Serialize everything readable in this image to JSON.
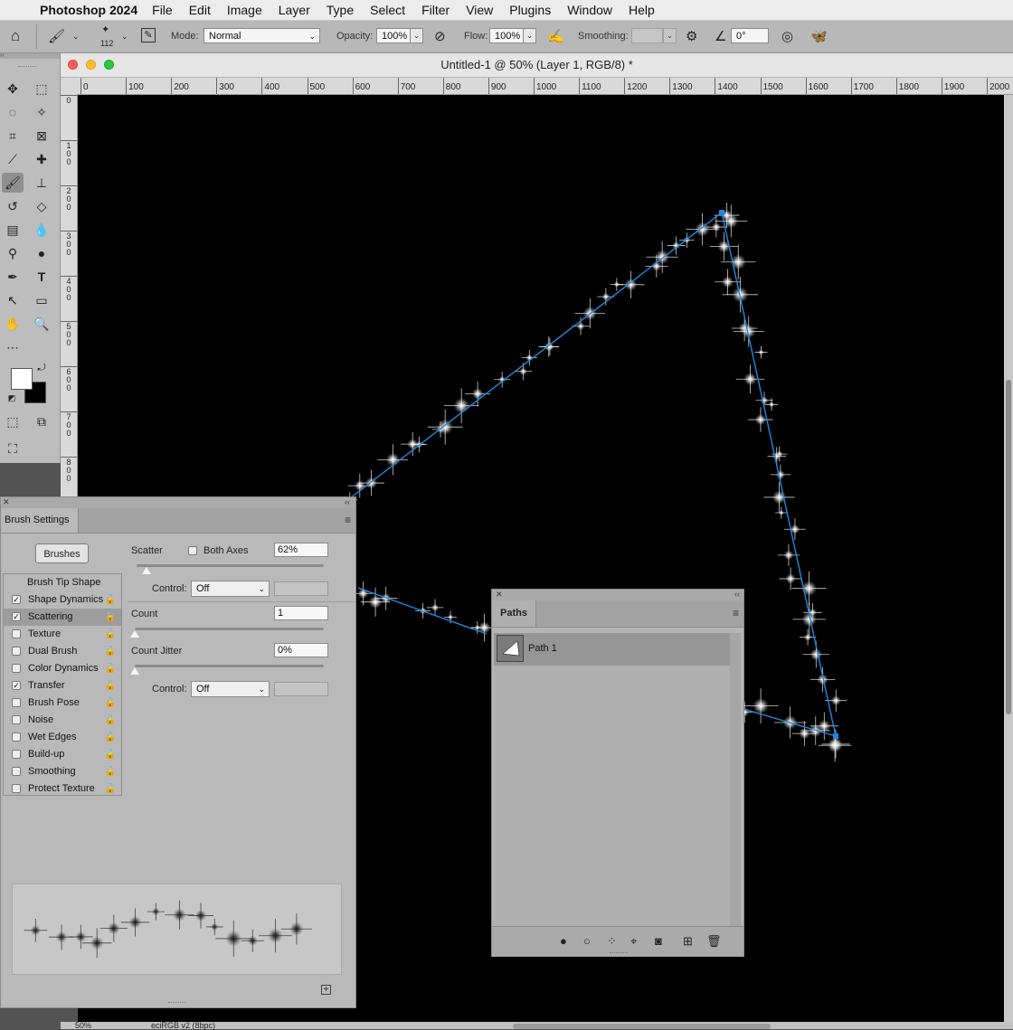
{
  "menubar": {
    "app_name": "Photoshop 2024",
    "items": [
      "File",
      "Edit",
      "Image",
      "Layer",
      "Type",
      "Select",
      "Filter",
      "View",
      "Plugins",
      "Window",
      "Help"
    ]
  },
  "options_bar": {
    "brush_size": "112",
    "mode_label": "Mode:",
    "mode_value": "Normal",
    "opacity_label": "Opacity:",
    "opacity_value": "100%",
    "flow_label": "Flow:",
    "flow_value": "100%",
    "smoothing_label": "Smoothing:",
    "smoothing_value": "",
    "angle_value": "0°"
  },
  "document": {
    "title": "Untitled-1 @ 50% (Layer 1, RGB/8) *",
    "ruler_h": [
      "0",
      "100",
      "200",
      "300",
      "400",
      "500",
      "600",
      "700",
      "800",
      "900",
      "1000",
      "1100",
      "1200",
      "1300",
      "1400",
      "1500",
      "1600",
      "1700",
      "1800",
      "1900",
      "2000"
    ],
    "ruler_v": [
      "0",
      "1\n0\n0",
      "2\n0\n0",
      "3\n0\n0",
      "4\n0\n0",
      "5\n0\n0",
      "6\n0\n0",
      "7\n0\n0",
      "8\n0\n0"
    ],
    "zoom": "50%",
    "color_profile": "eciRGB v2 (8bpc)"
  },
  "brush_settings": {
    "tab": "Brush Settings",
    "brushes_button": "Brushes",
    "items": [
      {
        "label": "Brush Tip Shape",
        "checkbox": false,
        "lock": false,
        "checked": false,
        "selected": false
      },
      {
        "label": "Shape Dynamics",
        "checkbox": true,
        "lock": true,
        "checked": true,
        "selected": false
      },
      {
        "label": "Scattering",
        "checkbox": true,
        "lock": true,
        "checked": true,
        "selected": true
      },
      {
        "label": "Texture",
        "checkbox": true,
        "lock": true,
        "checked": false,
        "selected": false
      },
      {
        "label": "Dual Brush",
        "checkbox": true,
        "lock": true,
        "checked": false,
        "selected": false
      },
      {
        "label": "Color Dynamics",
        "checkbox": true,
        "lock": true,
        "checked": false,
        "selected": false
      },
      {
        "label": "Transfer",
        "checkbox": true,
        "lock": true,
        "checked": true,
        "selected": false
      },
      {
        "label": "Brush Pose",
        "checkbox": true,
        "lock": true,
        "checked": false,
        "selected": false
      },
      {
        "label": "Noise",
        "checkbox": true,
        "lock": true,
        "checked": false,
        "selected": false
      },
      {
        "label": "Wet Edges",
        "checkbox": true,
        "lock": true,
        "checked": false,
        "selected": false
      },
      {
        "label": "Build-up",
        "checkbox": true,
        "lock": true,
        "checked": false,
        "selected": false
      },
      {
        "label": "Smoothing",
        "checkbox": true,
        "lock": true,
        "checked": false,
        "selected": false
      },
      {
        "label": "Protect Texture",
        "checkbox": true,
        "lock": true,
        "checked": false,
        "selected": false
      }
    ],
    "scatter_label": "Scatter",
    "both_axes_label": "Both Axes",
    "scatter_value": "62%",
    "scatter_level": 0.62,
    "control_label": "Control:",
    "control_value": "Off",
    "count_label": "Count",
    "count_value": "1",
    "count_jitter_label": "Count Jitter",
    "count_jitter_value": "0%",
    "control2_label": "Control:",
    "control2_value": "Off"
  },
  "paths_panel": {
    "tab": "Paths",
    "paths": [
      {
        "name": "Path 1"
      }
    ]
  },
  "colors": {
    "path_line": "#1e88e5",
    "canvas": "#000000",
    "foreground": "#ffffff",
    "background": "#000000"
  }
}
